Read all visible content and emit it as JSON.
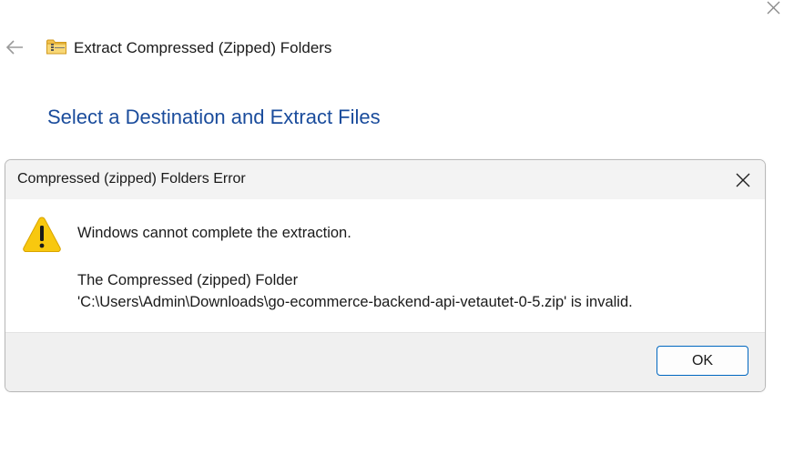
{
  "wizard": {
    "title": "Extract Compressed (Zipped) Folders",
    "heading": "Select a Destination and Extract Files"
  },
  "dialog": {
    "title": "Compressed (zipped) Folders Error",
    "message": "Windows cannot complete the extraction.",
    "detail_line1": "The Compressed (zipped) Folder",
    "detail_line2": "'C:\\Users\\Admin\\Downloads\\go-ecommerce-backend-api-vetautet-0-5.zip' is invalid.",
    "ok_label": "OK"
  },
  "icons": {
    "window_close": "close-icon",
    "back": "back-arrow-icon",
    "folder": "zipped-folder-icon",
    "dialog_close": "close-icon",
    "warning": "warning-icon"
  },
  "colors": {
    "heading": "#1a4c9c",
    "warning_fill": "#f8c80f",
    "ok_border": "#0067c0"
  }
}
